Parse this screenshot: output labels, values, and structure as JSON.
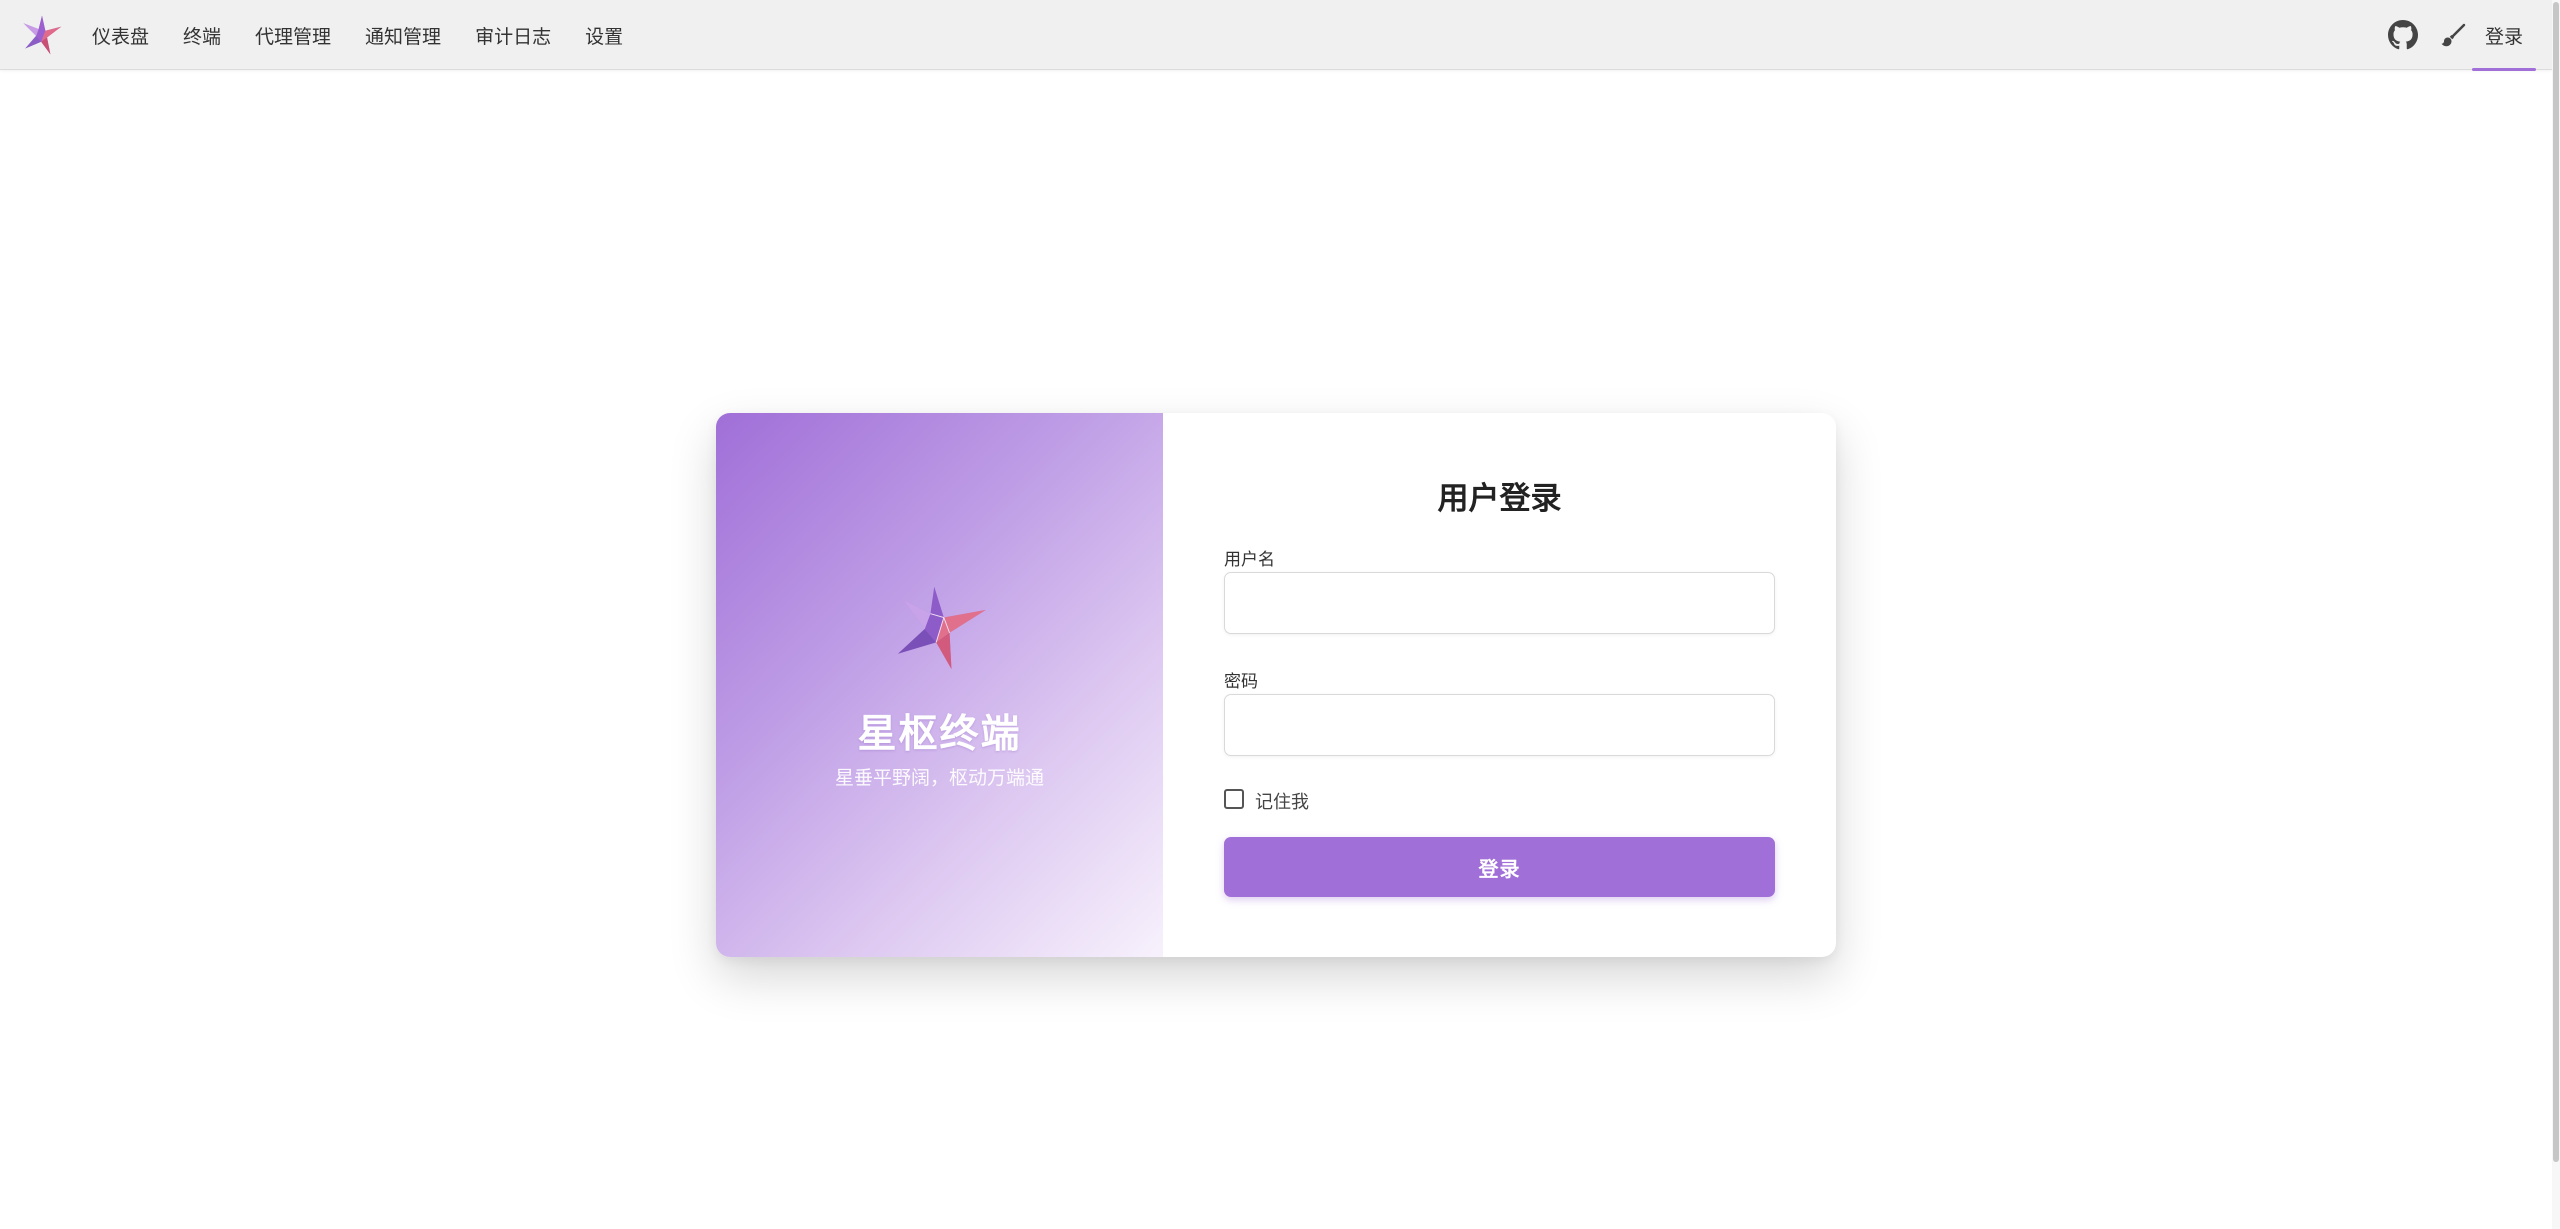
{
  "nav": {
    "logo_icon": "star-origami-logo-icon",
    "items": [
      {
        "label": "仪表盘"
      },
      {
        "label": "终端"
      },
      {
        "label": "代理管理"
      },
      {
        "label": "通知管理"
      },
      {
        "label": "审计日志"
      },
      {
        "label": "设置"
      }
    ],
    "github_icon": "github-icon",
    "theme_icon": "brush-icon",
    "login_label": "登录"
  },
  "brand": {
    "icon": "star-origami-logo-icon",
    "title": "星枢终端",
    "slogan": "星垂平野阔，枢动万端通"
  },
  "login_form": {
    "title": "用户登录",
    "username_label": "用户名",
    "username_value": "",
    "password_label": "密码",
    "password_value": "",
    "remember_label": "记住我",
    "remember_checked": false,
    "submit_label": "登录"
  },
  "colors": {
    "accent": "#a06fd8",
    "nav_background": "#f0f0f0",
    "page_background": "#ffffff"
  }
}
